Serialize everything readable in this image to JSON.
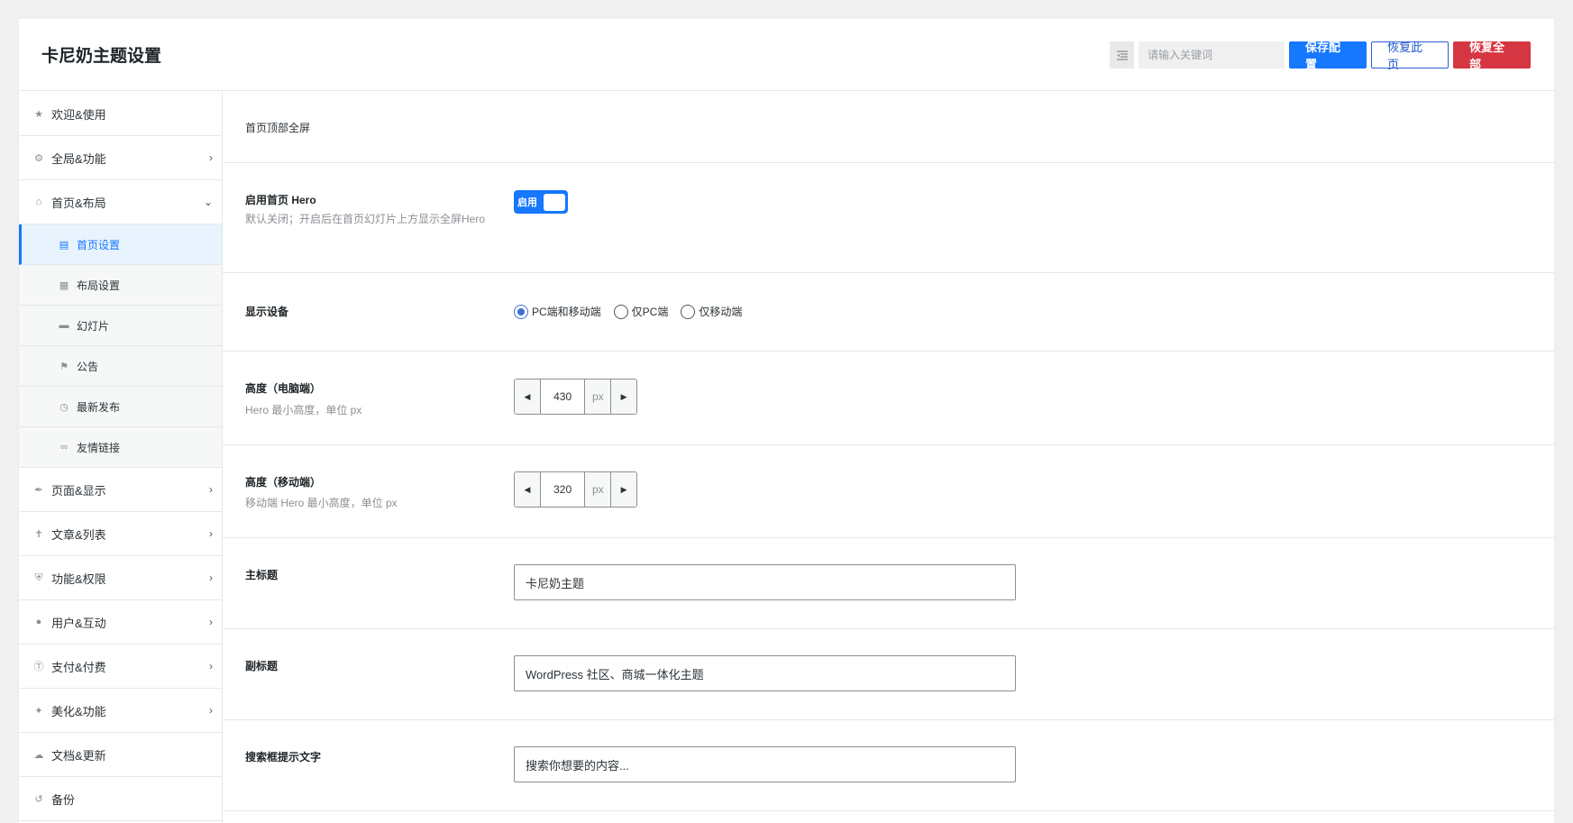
{
  "header": {
    "title": "卡尼奶主题设置",
    "search_placeholder": "请输入关键词",
    "save_label": "保存配置",
    "restore_page_label": "恢复此页",
    "restore_all_label": "恢复全部"
  },
  "sidebar": {
    "items": [
      {
        "label": "欢迎&使用",
        "icon": "welcome-icon"
      },
      {
        "label": "全局&功能",
        "icon": "gear-icon"
      },
      {
        "label": "首页&布局",
        "icon": "home-icon"
      }
    ],
    "sub_items": [
      {
        "label": "首页设置",
        "icon": "monitor-icon"
      },
      {
        "label": "布局设置",
        "icon": "grid-icon"
      },
      {
        "label": "幻灯片",
        "icon": "slides-icon"
      },
      {
        "label": "公告",
        "icon": "megaphone-icon"
      },
      {
        "label": "最新发布",
        "icon": "clock-icon"
      },
      {
        "label": "友情链接",
        "icon": "link-icon"
      }
    ],
    "items_after": [
      {
        "label": "页面&显示",
        "icon": "brush-icon"
      },
      {
        "label": "文章&列表",
        "icon": "pin-icon"
      },
      {
        "label": "功能&权限",
        "icon": "shield-icon"
      },
      {
        "label": "用户&互动",
        "icon": "user-icon"
      },
      {
        "label": "支付&付费",
        "icon": "dollar-icon"
      },
      {
        "label": "美化&功能",
        "icon": "magic-icon"
      },
      {
        "label": "文档&更新",
        "icon": "cloud-icon"
      },
      {
        "label": "备份",
        "icon": "history-icon"
      }
    ]
  },
  "content": {
    "section_title": "首页顶部全屏",
    "hero": {
      "label": "启用首页 Hero",
      "desc": "默认关闭；开启后在首页幻灯片上方显示全屏Hero",
      "toggle_text": "启用",
      "enabled": true
    },
    "device": {
      "label": "显示设备",
      "options": [
        "PC端和移动端",
        "仅PC端",
        "仅移动端"
      ],
      "selected": "PC端和移动端"
    },
    "height_pc": {
      "label": "高度（电脑端）",
      "desc": "Hero 最小高度，单位 px",
      "value": "430",
      "unit": "px"
    },
    "height_mobile": {
      "label": "高度（移动端）",
      "desc": "移动端 Hero 最小高度，单位 px",
      "value": "320",
      "unit": "px"
    },
    "main_title": {
      "label": "主标题",
      "value": "卡尼奶主题"
    },
    "sub_title": {
      "label": "副标题",
      "value": "WordPress 社区、商城一体化主题"
    },
    "search_hint": {
      "label": "搜索框提示文字",
      "value": "搜索你想要的内容..."
    }
  },
  "colors": {
    "accent": "#1677ff",
    "danger": "#d63642",
    "outline_blue": "#2c5fd2"
  }
}
